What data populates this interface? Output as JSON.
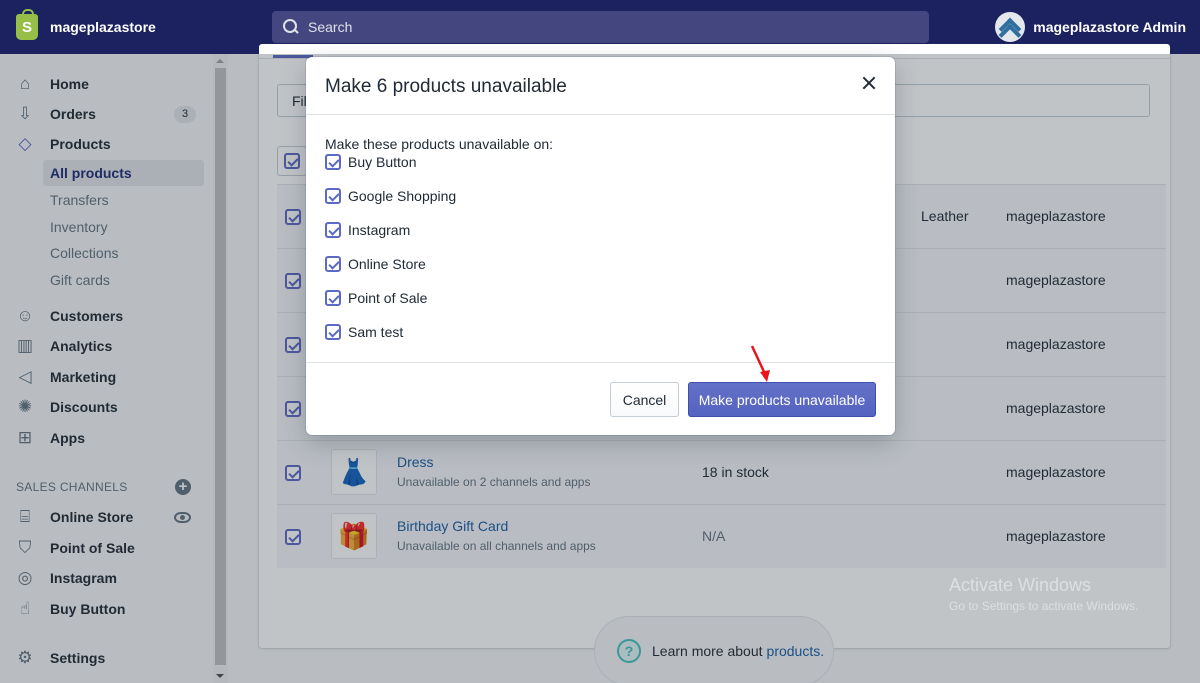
{
  "topbar": {
    "store_name": "mageplazastore",
    "search_placeholder": "Search",
    "account_name": "mageplazastore Admin"
  },
  "sidebar": {
    "items": [
      {
        "label": "Home",
        "icon": "home-icon"
      },
      {
        "label": "Orders",
        "icon": "orders-icon",
        "badge": "3"
      },
      {
        "label": "Products",
        "icon": "tag-icon"
      },
      {
        "label": "Customers",
        "icon": "person-icon"
      },
      {
        "label": "Analytics",
        "icon": "bar-chart-icon"
      },
      {
        "label": "Marketing",
        "icon": "megaphone-icon"
      },
      {
        "label": "Discounts",
        "icon": "discount-icon"
      },
      {
        "label": "Apps",
        "icon": "apps-icon"
      }
    ],
    "product_subitems": [
      {
        "label": "All products",
        "active": true
      },
      {
        "label": "Transfers"
      },
      {
        "label": "Inventory"
      },
      {
        "label": "Collections"
      },
      {
        "label": "Gift cards"
      }
    ],
    "sales_channels_heading": "SALES CHANNELS",
    "channels": [
      {
        "label": "Online Store",
        "icon": "store-icon"
      },
      {
        "label": "Point of Sale",
        "icon": "pos-bag-icon"
      },
      {
        "label": "Instagram",
        "icon": "instagram-icon"
      },
      {
        "label": "Buy Button",
        "icon": "buy-button-icon"
      }
    ],
    "settings_label": "Settings"
  },
  "products": {
    "filter_label": "Filter",
    "rows": [
      {
        "name": "",
        "subtitle": "",
        "inventory": "",
        "type": "Leather",
        "vendor": "mageplazastore"
      },
      {
        "name": "",
        "subtitle": "",
        "inventory": "",
        "type": "",
        "vendor": "mageplazastore"
      },
      {
        "name": "",
        "subtitle": "",
        "inventory": "",
        "type": "",
        "vendor": "mageplazastore"
      },
      {
        "name": "",
        "subtitle": "",
        "inventory": "",
        "type": "",
        "vendor": "mageplazastore"
      },
      {
        "name": "Dress",
        "subtitle": "Unavailable on 2 channels and apps",
        "inventory": "18 in stock",
        "type": "",
        "vendor": "mageplazastore"
      },
      {
        "name": "Birthday Gift Card",
        "subtitle": "Unavailable on all channels and apps",
        "inventory": "N/A",
        "type": "",
        "vendor": "mageplazastore"
      }
    ]
  },
  "learn_more": {
    "text": "Learn more about",
    "link": "products."
  },
  "modal": {
    "title": "Make 6 products unavailable",
    "intro": "Make these products unavailable on:",
    "channels": [
      {
        "label": "Buy Button",
        "checked": true
      },
      {
        "label": "Google Shopping",
        "checked": true
      },
      {
        "label": "Instagram",
        "checked": true
      },
      {
        "label": "Online Store",
        "checked": true
      },
      {
        "label": "Point of Sale",
        "checked": true
      },
      {
        "label": "Sam test",
        "checked": true
      }
    ],
    "cancel_label": "Cancel",
    "confirm_label": "Make products unavailable"
  },
  "watermark": {
    "line1": "Activate Windows",
    "line2": "Go to Settings to activate Windows."
  },
  "colors": {
    "topbar": "#1c2260",
    "primary": "#5c6ac4",
    "link": "#1a5fa3",
    "annotation_arrow": "#e8161b"
  }
}
